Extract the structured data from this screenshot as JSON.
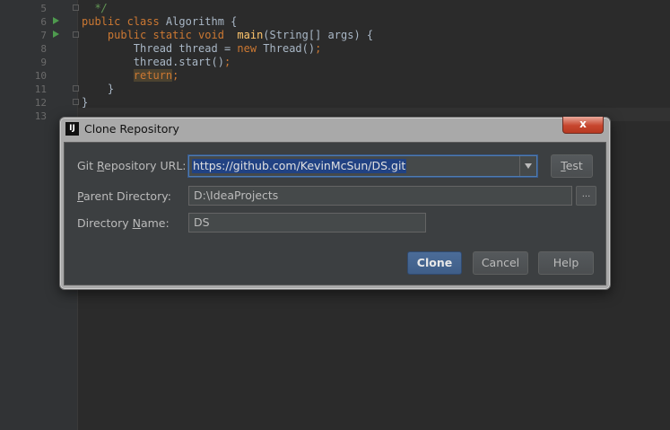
{
  "editor": {
    "line_numbers": [
      "5",
      "6",
      "7",
      "8",
      "9",
      "10",
      "11",
      "12",
      "13"
    ],
    "lines": [
      {
        "n": "5",
        "parts": [
          {
            "t": "  ",
            "c": ""
          },
          {
            "t": "*/",
            "c": "cm"
          }
        ]
      },
      {
        "n": "6",
        "parts": [
          {
            "t": "public class ",
            "c": "kw"
          },
          {
            "t": "Algorithm {",
            "c": ""
          }
        ]
      },
      {
        "n": "7",
        "parts": [
          {
            "t": "    public static void  ",
            "c": "kw"
          },
          {
            "t": "main",
            "c": "fn"
          },
          {
            "t": "(String[] args) {",
            "c": ""
          }
        ]
      },
      {
        "n": "8",
        "parts": [
          {
            "t": "        Thread thread = ",
            "c": ""
          },
          {
            "t": "new ",
            "c": "kw"
          },
          {
            "t": "Thread()",
            "c": ""
          },
          {
            "t": ";",
            "c": "kw"
          }
        ]
      },
      {
        "n": "9",
        "parts": [
          {
            "t": "        thread.start()",
            "c": ""
          },
          {
            "t": ";",
            "c": "kw"
          }
        ]
      },
      {
        "n": "10",
        "parts": [
          {
            "t": "        ",
            "c": ""
          },
          {
            "t": "return",
            "c": "kw ret-hl"
          },
          {
            "t": ";",
            "c": "kw"
          }
        ]
      },
      {
        "n": "11",
        "parts": [
          {
            "t": "    }",
            "c": ""
          }
        ]
      },
      {
        "n": "12",
        "parts": [
          {
            "t": "}",
            "c": ""
          }
        ]
      },
      {
        "n": "13",
        "parts": [
          {
            "t": "",
            "c": ""
          }
        ]
      }
    ]
  },
  "dialog": {
    "app_icon": "IJ",
    "title": "Clone Repository",
    "close_label": "x",
    "git_url_label_pre": "Git ",
    "git_url_label_mnemonic": "R",
    "git_url_label_post": "epository URL:",
    "git_url_value": "https://github.com/KevinMcSun/DS.git",
    "test_label_mnemonic": "T",
    "test_label_post": "est",
    "parent_dir_label_mnemonic": "P",
    "parent_dir_label_post": "arent Directory:",
    "parent_dir_value": "D:\\IdeaProjects",
    "browse_label": "...",
    "dir_name_label_pre": "Directory ",
    "dir_name_label_mnemonic": "N",
    "dir_name_label_post": "ame:",
    "dir_name_value": "DS",
    "clone_label": "Clone",
    "cancel_label": "Cancel",
    "help_label": "Help"
  },
  "colors": {
    "editor_bg": "#2b2b2b",
    "keyword": "#cc7832",
    "function": "#ffc66d",
    "comment": "#629755",
    "selection": "#214283"
  }
}
